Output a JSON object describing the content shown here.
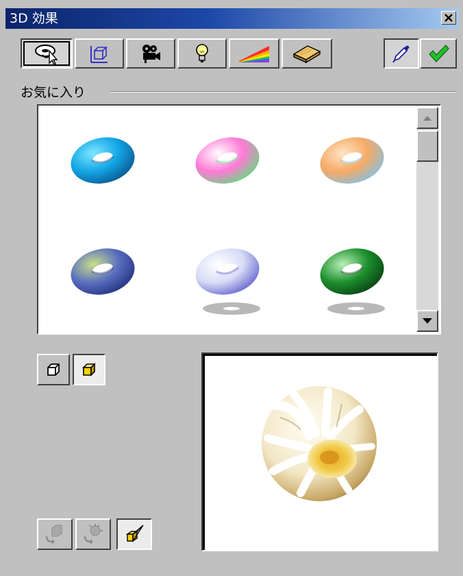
{
  "window": {
    "title": "3D 効果",
    "close_icon": "close-icon"
  },
  "toolbar": {
    "buttons": [
      {
        "name": "favorites-tool",
        "icon": "favorites-cursor-icon",
        "active": true
      },
      {
        "name": "geometry-tool",
        "icon": "geometry-icon",
        "active": false
      },
      {
        "name": "camera-tool",
        "icon": "movie-camera-icon",
        "active": false
      },
      {
        "name": "lighting-tool",
        "icon": "light-bulb-icon",
        "active": false
      },
      {
        "name": "color-tool",
        "icon": "rainbow-color-icon",
        "active": false
      },
      {
        "name": "material-tool",
        "icon": "material-tile-icon",
        "active": false
      },
      {
        "name": "pick-tool",
        "icon": "eyedropper-icon",
        "active": true
      },
      {
        "name": "apply-tool",
        "icon": "checkmark-icon",
        "active": false
      }
    ]
  },
  "favorites": {
    "label": "お気に入り",
    "items": [
      {
        "name": "favorite-blue-torus",
        "colors": [
          "#7fe6ff",
          "#12a6e6",
          "#0a4f88"
        ]
      },
      {
        "name": "favorite-rainbow-torus",
        "colors": [
          "#ffffff",
          "#ff7ad6",
          "#5ce07a"
        ]
      },
      {
        "name": "favorite-peach-torus",
        "colors": [
          "#ffe4c4",
          "#f6aa66",
          "#7ec2e8"
        ]
      },
      {
        "name": "favorite-navy-green-torus",
        "colors": [
          "#c9e088",
          "#5a6fbf",
          "#1e2b7a"
        ]
      },
      {
        "name": "favorite-white-torus",
        "colors": [
          "#ffffff",
          "#d8dcf6",
          "#5a5acb"
        ]
      },
      {
        "name": "favorite-green-torus",
        "colors": [
          "#b8f0b8",
          "#1d8f2d",
          "#063a10"
        ]
      }
    ]
  },
  "mode_buttons": [
    {
      "name": "wireframe-mode-button",
      "icon": "wireframe-cube-icon",
      "pressed": false
    },
    {
      "name": "shaded-mode-button",
      "icon": "shaded-cube-icon",
      "pressed": true
    }
  ],
  "bottom_buttons": [
    {
      "name": "rotate-object-button",
      "icon": "rotate-object-icon",
      "enabled": false
    },
    {
      "name": "rotate-light-button",
      "icon": "rotate-light-icon",
      "enabled": false
    },
    {
      "name": "perspective-button",
      "icon": "perspective-cube-icon",
      "enabled": true
    }
  ],
  "preview": {
    "object": "sphere",
    "texture": "flower-texture"
  }
}
